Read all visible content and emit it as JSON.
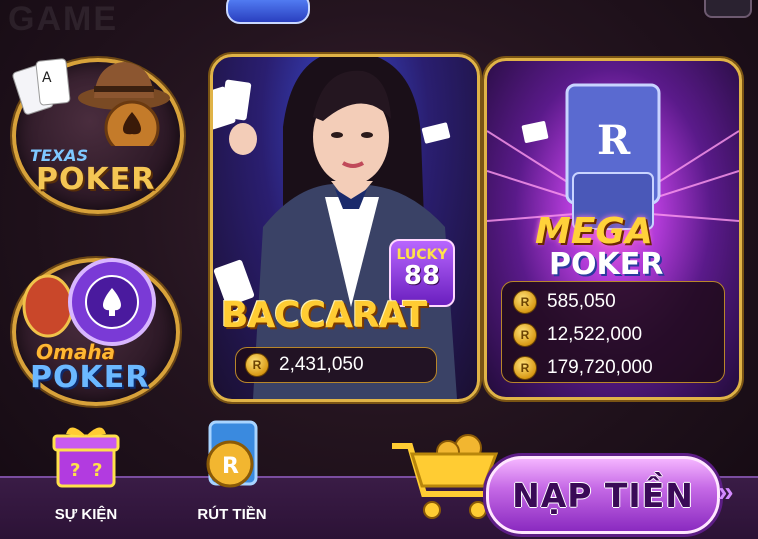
{
  "background": {
    "watermark": "GAME"
  },
  "games": [
    {
      "id": "texas-poker",
      "small_label": "TEXAS",
      "big_label": "POKER",
      "colors": {
        "small": "#7ec8ff",
        "big": "#f4c654"
      }
    },
    {
      "id": "omaha-poker",
      "small_label": "Omaha",
      "big_label": "POKER",
      "colors": {
        "small": "#ffb733",
        "big": "#6bb8ff"
      }
    }
  ],
  "baccarat": {
    "title": "BACCARAT",
    "badge": {
      "top": "LUCKY",
      "bottom": "88"
    },
    "coin_symbol": "R",
    "pot": "2,431,050"
  },
  "mega_poker": {
    "title_top": "MEGA",
    "title_bottom": "POKER",
    "chip_letter": "R",
    "coin_symbol": "R",
    "pots": [
      "585,050",
      "12,522,000",
      "179,720,000"
    ]
  },
  "bottom_nav": {
    "events_label": "SỰ KIỆN",
    "withdraw_label": "RÚT TIỀN",
    "deposit_label": "NẠP TIỀN",
    "withdraw_icon_letter": "R"
  },
  "colors": {
    "gold": "#e0b347",
    "purple": "#8a2ac0"
  }
}
